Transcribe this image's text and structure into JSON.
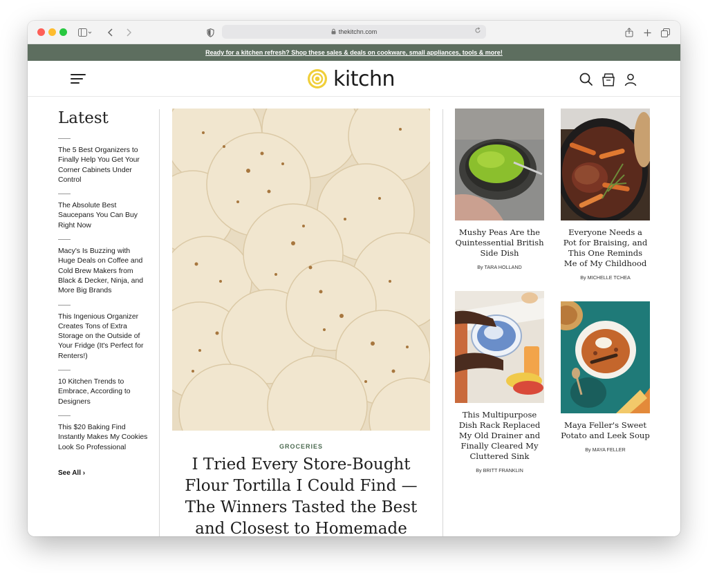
{
  "browser": {
    "url": "thekitchn.com",
    "icons": [
      "sidebar-icon",
      "back-icon",
      "forward-icon",
      "shield-icon",
      "lock-icon",
      "reload-icon",
      "share-icon",
      "new-tab-icon",
      "tabs-icon"
    ]
  },
  "promo_banner": {
    "text": "Ready for a kitchen refresh? Shop these sales & deals on cookware, small appliances, tools & more!",
    "bg_color": "#5d6e5f"
  },
  "header": {
    "logo_text": "kitchn",
    "logo_color": "#e3c22a",
    "icons": [
      "menu-icon",
      "search-icon",
      "recipe-box-icon",
      "account-icon"
    ]
  },
  "latest": {
    "title": "Latest",
    "items": [
      "The 5 Best Organizers to Finally Help You Get Your Corner Cabinets Under Control",
      "The Absolute Best Saucepans You Can Buy Right Now",
      "Macy's Is Buzzing with Huge Deals on Coffee and Cold Brew Makers from Black & Decker, Ninja, and More Big Brands",
      "This Ingenious Organizer Creates Tons of Extra Storage on the Outside of Your Fridge (It's Perfect for Renters!)",
      "10 Kitchen Trends to Embrace, According to Designers",
      "This $20 Baking Find Instantly Makes My Cookies Look So Professional"
    ],
    "see_all": "See All ›"
  },
  "hero": {
    "category": "GROCERIES",
    "title": "I Tried Every Store-Bought Flour Tortilla I Could Find — The Winners Tasted the Best and Closest to Homemade",
    "category_color": "#4d6b52"
  },
  "cards": [
    {
      "title": "Mushy Peas Are the Quintessential British Side Dish",
      "byline": "By TARA HOLLAND"
    },
    {
      "title": "Everyone Needs a Pot for Braising, and This One Reminds Me of My Childhood",
      "byline": "By MICHELLE TCHEA"
    },
    {
      "title": "This Multipurpose Dish Rack Replaced My Old Drainer and Finally Cleared My Cluttered Sink",
      "byline": "By BRITT FRANKLIN"
    },
    {
      "title": "Maya Feller's Sweet Potato and Leek Soup",
      "byline": "By MAYA FELLER"
    }
  ]
}
